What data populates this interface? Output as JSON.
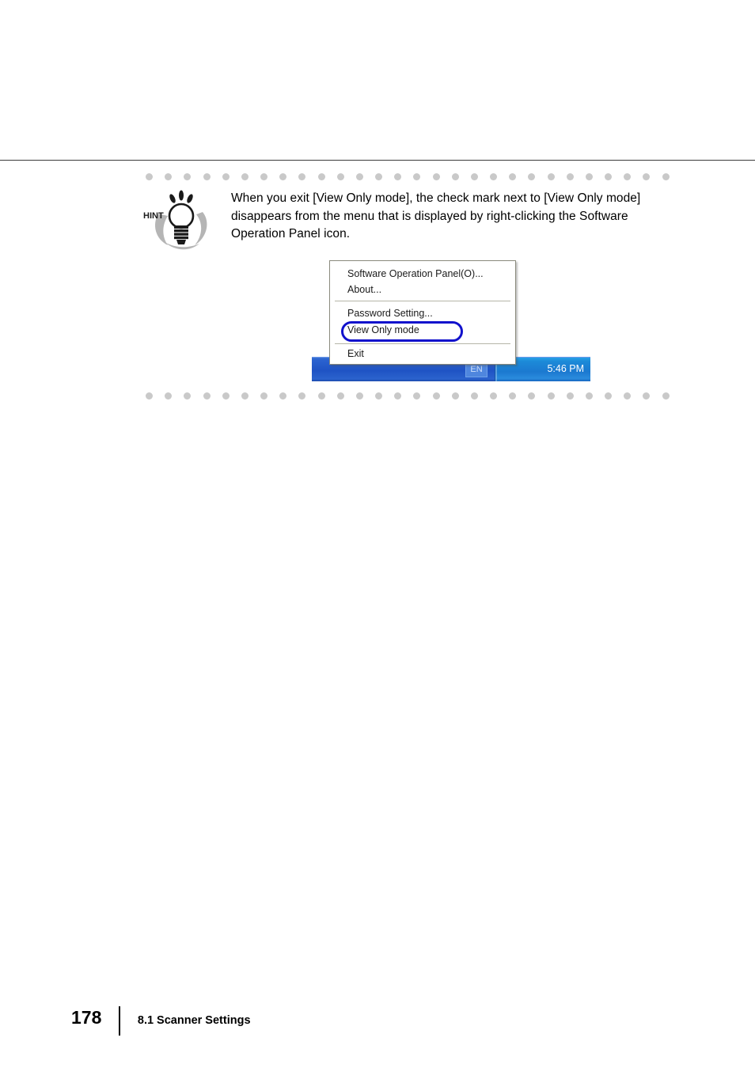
{
  "page": {
    "number": "178",
    "section": "8.1 Scanner Settings"
  },
  "hint": {
    "icon_label": "HINT",
    "icon_name": "lightbulb-hint-icon",
    "text": "When you exit [View Only mode], the check mark next to [View Only mode] disappears from the menu that is displayed by right-clicking the Software Operation Panel icon."
  },
  "figure": {
    "context_menu": {
      "items": [
        {
          "label": "Software Operation Panel(O)..."
        },
        {
          "label": "About..."
        },
        {
          "label": "Password Setting..."
        },
        {
          "label": "View Only mode",
          "highlighted": true
        },
        {
          "label": "Exit"
        }
      ]
    },
    "taskbar": {
      "language_indicator": "EN",
      "clock": "5:46 PM",
      "chevron_icon": "show-hidden-icons-chevron",
      "tray_icon": "software-operation-panel-tray-icon",
      "cursor_icon": "hand-pointer-cursor"
    },
    "highlight_color": "#1111cc"
  },
  "decor": {
    "dot_count": 28,
    "dot_color": "#c9c9c9",
    "rule_color": "#3a3a3a"
  }
}
